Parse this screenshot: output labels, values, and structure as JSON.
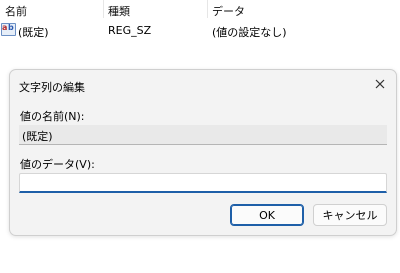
{
  "list": {
    "columns": [
      "名前",
      "種類",
      "データ"
    ],
    "rows": [
      {
        "icon": "registry-string-icon",
        "name": "(既定)",
        "type": "REG_SZ",
        "data": "(値の設定なし)"
      }
    ]
  },
  "dialog": {
    "title": "文字列の編集",
    "close_icon": "close-icon",
    "value_name_label": "値の名前(N):",
    "value_name": "(既定)",
    "value_data_label": "値のデータ(V):",
    "value_data": "",
    "ok_label": "OK",
    "cancel_label": "キャンセル"
  },
  "colors": {
    "accent": "#1e5fa8",
    "dialog_bg": "#f3f3f3",
    "readonly_bg": "#e9e9e9"
  }
}
